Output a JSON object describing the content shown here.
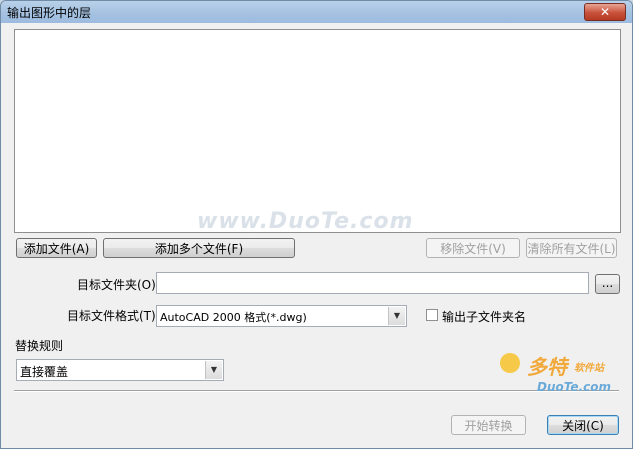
{
  "window": {
    "title": "输出图形中的层",
    "close_label": "✕"
  },
  "file_buttons": {
    "add_file": "添加文件(A)",
    "add_multiple": "添加多个文件(F)",
    "remove_file": "移除文件(V)",
    "clear_all": "清除所有文件(L)"
  },
  "target_folder": {
    "label": "目标文件夹(O)",
    "value": "",
    "browse_label": "..."
  },
  "target_format": {
    "label": "目标文件格式(T)",
    "value": "AutoCAD 2000 格式(*.dwg)"
  },
  "output_subfolder": {
    "label": "输出子文件夹名",
    "checked": false
  },
  "replace_rule": {
    "label": "替换规则",
    "value": "直接覆盖"
  },
  "footer": {
    "start_label": "开始转换",
    "close_label": "关闭(C)"
  },
  "watermarks": {
    "site": "www.DuoTe.com",
    "brand": "多特",
    "brand_sub": "软件站",
    "brand_url": "DuoTe.com"
  }
}
